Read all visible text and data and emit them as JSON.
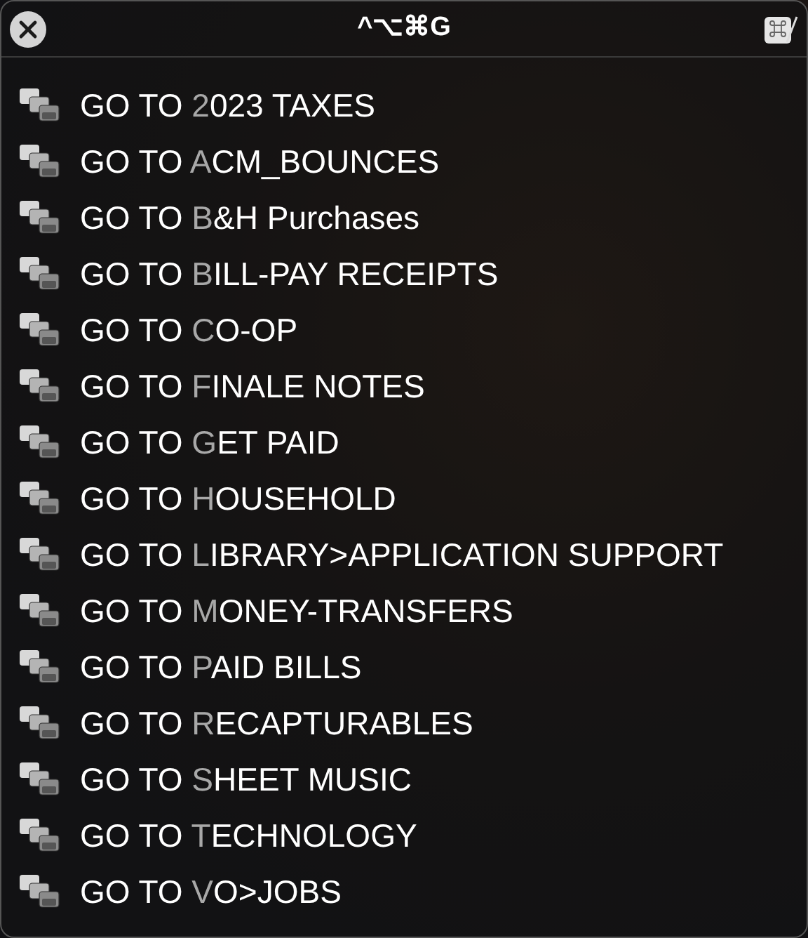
{
  "window": {
    "title": "^⌥⌘G"
  },
  "items": [
    {
      "lead": "GO TO ",
      "key": "2",
      "rest": "023 TAXES"
    },
    {
      "lead": "GO TO ",
      "key": "A",
      "rest": "CM_BOUNCES"
    },
    {
      "lead": "GO TO ",
      "key": "B",
      "rest": "&H Purchases"
    },
    {
      "lead": "GO TO ",
      "key": "B",
      "rest": "ILL-PAY RECEIPTS"
    },
    {
      "lead": "GO TO ",
      "key": "C",
      "rest": "O-OP"
    },
    {
      "lead": "GO TO ",
      "key": "F",
      "rest": "INALE NOTES"
    },
    {
      "lead": "GO TO ",
      "key": "G",
      "rest": "ET PAID"
    },
    {
      "lead": "GO TO ",
      "key": "H",
      "rest": "OUSEHOLD"
    },
    {
      "lead": "GO TO ",
      "key": "L",
      "rest": "IBRARY>APPLICATION SUPPORT"
    },
    {
      "lead": "GO TO ",
      "key": "M",
      "rest": "ONEY-TRANSFERS"
    },
    {
      "lead": "GO TO ",
      "key": "P",
      "rest": "AID BILLS"
    },
    {
      "lead": "GO TO ",
      "key": "R",
      "rest": "ECAPTURABLES"
    },
    {
      "lead": "GO TO ",
      "key": "S",
      "rest": "HEET MUSIC"
    },
    {
      "lead": "GO TO ",
      "key": "T",
      "rest": "ECHNOLOGY"
    },
    {
      "lead": "GO TO ",
      "key": "V",
      "rest": "O>JOBS"
    }
  ]
}
